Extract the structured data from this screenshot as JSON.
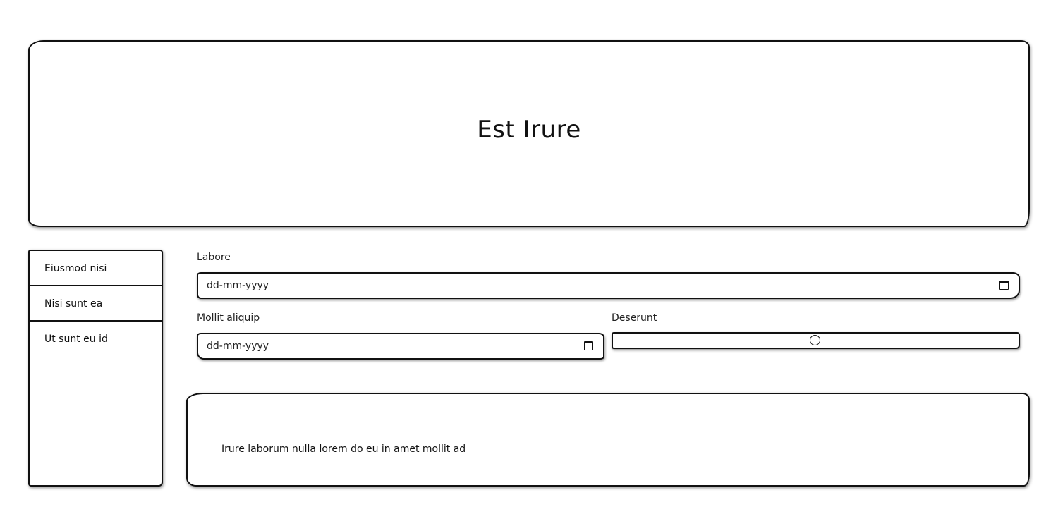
{
  "header": {
    "title": "Est Irure"
  },
  "sidebar": {
    "items": [
      {
        "label": "Eiusmod nisi"
      },
      {
        "label": "Nisi sunt ea"
      },
      {
        "label": "Ut sunt eu id"
      }
    ]
  },
  "form": {
    "labore": {
      "label": "Labore",
      "placeholder": "dd-mm-yyyy",
      "icon": "calendar-icon"
    },
    "mollit": {
      "label": "Mollit aliquip",
      "placeholder": "dd-mm-yyyy",
      "icon": "calendar-icon"
    },
    "deserunt": {
      "label": "Deserunt",
      "value_fraction": 0.5
    }
  },
  "note": {
    "text": "Irure laborum nulla lorem do eu in amet mollit ad"
  }
}
